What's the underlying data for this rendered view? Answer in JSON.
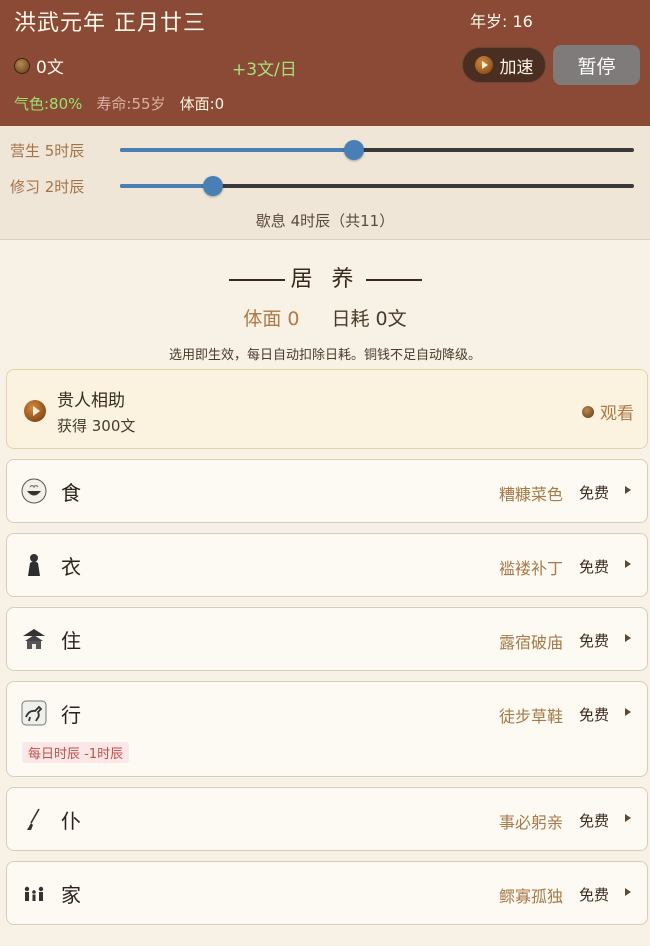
{
  "header": {
    "date": "洪武元年 正月廿三",
    "age": "年岁: 16",
    "coins": "0文",
    "income": "+3文/日",
    "speed_label": "加速",
    "pause_label": "暂停",
    "stat_qi": "气色:80%",
    "stat_life": "寿命:55岁",
    "stat_face": "体面:0"
  },
  "sliders": [
    {
      "label": "营生 5时辰",
      "value": 5,
      "max": 11
    },
    {
      "label": "修习 2时辰",
      "value": 2,
      "max": 11
    }
  ],
  "rest_text": "歇息 4时辰（共11）",
  "section": {
    "title": "居 养",
    "face": "体面 0",
    "daily": "日耗 0文",
    "note": "选用即生效，每日自动扣除日耗。铜钱不足自动降级。"
  },
  "ad": {
    "title": "贵人相助",
    "subtitle": "获得 300文",
    "action": "观看"
  },
  "items": [
    {
      "name": "食",
      "level": "糟糠菜色",
      "price": "免费",
      "icon": "bowl-icon"
    },
    {
      "name": "衣",
      "level": "褴褛补丁",
      "price": "免费",
      "icon": "cloak-icon"
    },
    {
      "name": "住",
      "level": "露宿破庙",
      "price": "免费",
      "icon": "temple-icon"
    },
    {
      "name": "行",
      "level": "徒步草鞋",
      "price": "免费",
      "icon": "horse-icon",
      "tag": "每日时辰 -1时辰"
    },
    {
      "name": "仆",
      "level": "事必躬亲",
      "price": "免费",
      "icon": "broom-icon"
    },
    {
      "name": "家",
      "level": "鳏寡孤独",
      "price": "免费",
      "icon": "family-icon"
    }
  ],
  "colors": {
    "header_bg": "#8b4a35",
    "accent_blue": "#4a7fb5",
    "gold": "#b07a45",
    "green": "#9ee06f"
  }
}
